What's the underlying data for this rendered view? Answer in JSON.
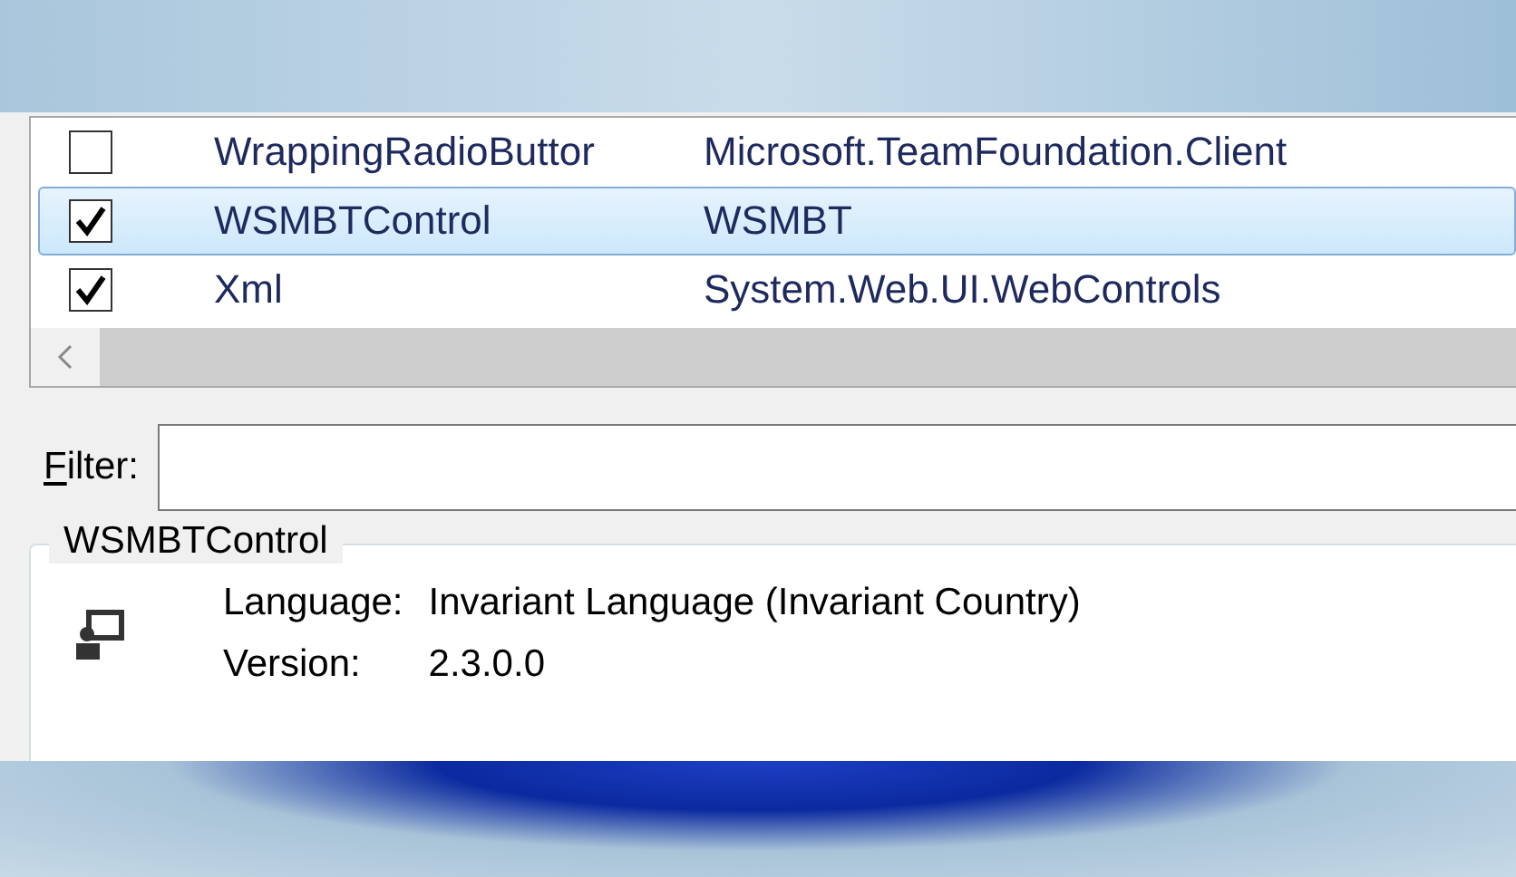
{
  "items": [
    {
      "name": "WrappingRadioButtor",
      "namespace": "Microsoft.TeamFoundation.Client",
      "checked": false,
      "selected": false
    },
    {
      "name": "WSMBTControl",
      "namespace": "WSMBT",
      "checked": true,
      "selected": true
    },
    {
      "name": "Xml",
      "namespace": "System.Web.UI.WebControls",
      "checked": true,
      "selected": false
    }
  ],
  "filter": {
    "label": "Filter:"
  },
  "details": {
    "title": "WSMBTControl",
    "fields": [
      {
        "label": "Language:",
        "value": "Invariant Language (Invariant Country)"
      },
      {
        "label": "Version:",
        "value": "2.3.0.0"
      }
    ]
  }
}
